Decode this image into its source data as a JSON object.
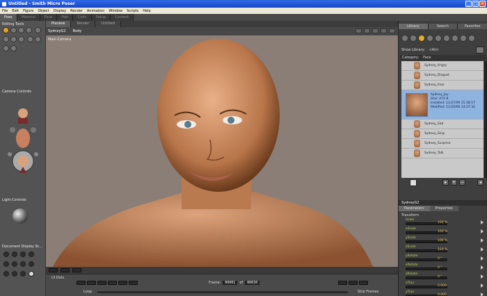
{
  "window": {
    "title": "Untitled - Smith Micro Poser"
  },
  "menu": [
    "File",
    "Edit",
    "Figure",
    "Object",
    "Display",
    "Render",
    "Animation",
    "Window",
    "Scripts",
    "Help"
  ],
  "rooms": [
    {
      "label": "Pose",
      "active": true
    },
    {
      "label": "Material",
      "active": false
    },
    {
      "label": "Face",
      "active": false
    },
    {
      "label": "Hair",
      "active": false
    },
    {
      "label": "Cloth",
      "active": false
    },
    {
      "label": "Setup",
      "active": false
    },
    {
      "label": "Content",
      "active": false
    }
  ],
  "left": {
    "editing_tools": "Editing Tools",
    "camera_controls": "Camera Controls",
    "light_controls": "Light Controls",
    "document_display": "Document Display St..."
  },
  "viewport": {
    "tabs": [
      {
        "label": "Preview",
        "active": true
      },
      {
        "label": "Render",
        "active": false
      },
      {
        "label": "Untitled",
        "active": false
      }
    ],
    "figure": "SydneyG2",
    "part": "Body",
    "camera": "Main Camera"
  },
  "timeline": {
    "ui_dots": "UI Dots",
    "frame_label": "Frame:",
    "frame_value": "00001",
    "of_label": "of",
    "frame_total": "00030",
    "loop": "Loop",
    "skip_frames": "Skip Frames"
  },
  "library": {
    "tabs": [
      {
        "label": "Library",
        "active": true
      },
      {
        "label": "Search",
        "active": false
      },
      {
        "label": "Favorites",
        "active": false
      }
    ],
    "show_library_label": "Show Library:",
    "show_library_value": "<All>",
    "category_label": "Category:",
    "category_value": "Face",
    "items": [
      "Sydney_Angry",
      "Sydney_Disgust",
      "Sydney_Fear",
      "Sydney_Joy",
      "Sydney_Sad",
      "Sydney_Sing",
      "Sydney_Surprise",
      "Sydney_Talk"
    ],
    "selected": {
      "name": "Sydney_Joy",
      "size": "Size: 472 B",
      "installed": "Installed: 11/27/09 15:38:17",
      "modified": "Modified: 11/20/06 14:37:32"
    }
  },
  "parameters": {
    "figure": "SydneyG2",
    "tabs": [
      {
        "label": "Parameters",
        "active": true
      },
      {
        "label": "Properties",
        "active": false
      }
    ],
    "group": "Transform",
    "rows": [
      {
        "name": "Scale",
        "value": "100 %"
      },
      {
        "name": "xScale",
        "value": "100 %"
      },
      {
        "name": "yScale",
        "value": "100 %"
      },
      {
        "name": "zScale",
        "value": "100 %"
      },
      {
        "name": "yRotate",
        "value": "0 °"
      },
      {
        "name": "xRotate",
        "value": "0 °"
      },
      {
        "name": "zRotate",
        "value": "0 °"
      },
      {
        "name": "xTran",
        "value": "0.000"
      },
      {
        "name": "yTran",
        "value": "0.000"
      },
      {
        "name": "zTran",
        "value": "0.000"
      }
    ]
  }
}
